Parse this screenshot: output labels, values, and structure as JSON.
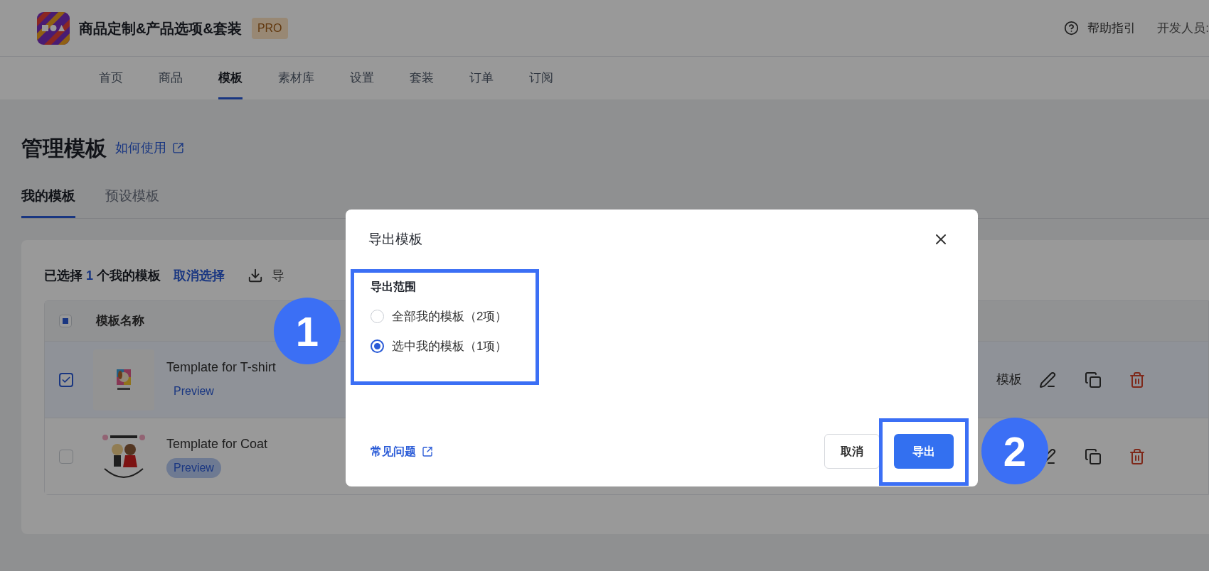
{
  "app": {
    "name": "商品定制&产品选项&套装",
    "badge": "PRO"
  },
  "header_links": {
    "help": "帮助指引",
    "developer": "开发人员:"
  },
  "nav": [
    {
      "label": "首页",
      "selected": false
    },
    {
      "label": "商品",
      "selected": false
    },
    {
      "label": "模板",
      "selected": true
    },
    {
      "label": "素材库",
      "selected": false
    },
    {
      "label": "设置",
      "selected": false
    },
    {
      "label": "套装",
      "selected": false
    },
    {
      "label": "订单",
      "selected": false
    },
    {
      "label": "订阅",
      "selected": false
    }
  ],
  "page": {
    "title": "管理模板",
    "help_link": "如何使用"
  },
  "tabs": [
    {
      "label": "我的模板",
      "selected": true
    },
    {
      "label": "预设模板",
      "selected": false
    }
  ],
  "selection_bar": {
    "prefix": "已选择",
    "count": "1",
    "suffix": "个我的模板",
    "clear": "取消选择",
    "action": "导"
  },
  "table": {
    "select_all": {
      "indeterminate": true
    },
    "columns": [
      "模板名称"
    ],
    "rows": [
      {
        "name": "Template for T-shirt",
        "preview": "Preview",
        "checked": true,
        "preview_highlighted": false,
        "action": "模板"
      },
      {
        "name": "Template for Coat",
        "preview": "Preview",
        "checked": false,
        "preview_highlighted": true
      }
    ]
  },
  "modal": {
    "title": "导出模板",
    "section_label": "导出范围",
    "options": [
      {
        "label": "全部我的模板（2项）",
        "selected": false
      },
      {
        "label": "选中我的模板（1项）",
        "selected": true
      }
    ],
    "faq_link": "常见问题",
    "cancel": "取消",
    "confirm": "导出"
  },
  "annotations": [
    "1",
    "2"
  ]
}
